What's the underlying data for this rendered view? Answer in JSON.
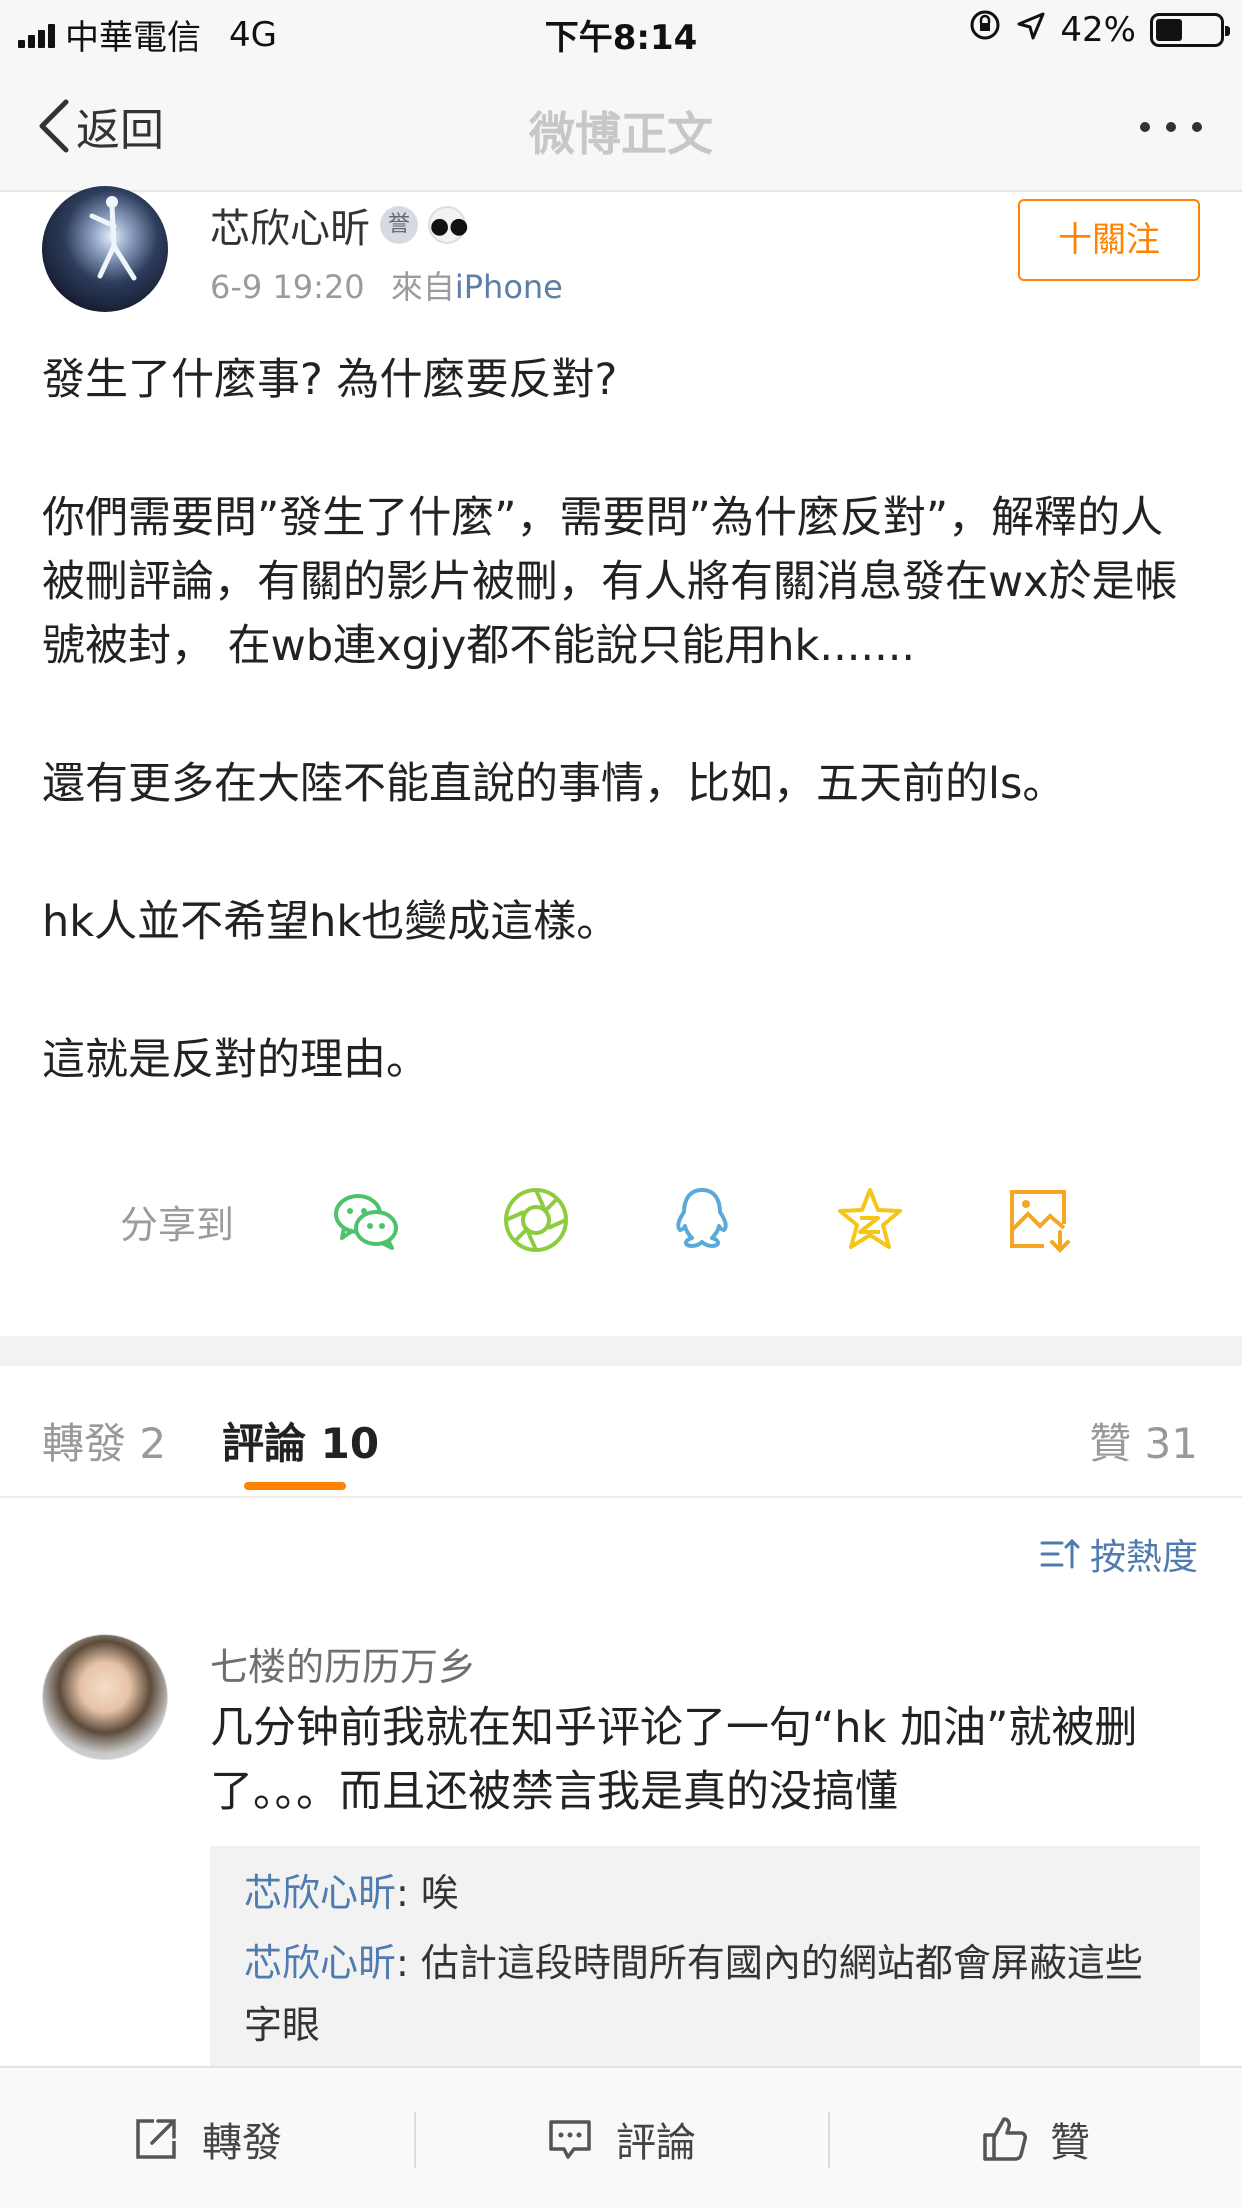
{
  "status_bar": {
    "carrier": "中華電信",
    "network": "4G",
    "time": "下午8:14",
    "battery_percent": "42%"
  },
  "nav": {
    "back_label": "返回",
    "title": "微博正文"
  },
  "post": {
    "author": "芯欣心昕",
    "timestamp": "6-9 19:20",
    "source_prefix": "來自",
    "source": "iPhone",
    "follow_label": "十關注",
    "paragraphs": [
      "發生了什麼事? 為什麼要反對?",
      "你們需要問”發生了什麼”，需要問”為什麼反對”，解釋的人被刪評論，有關的影片被刪，有人將有關消息發在wx於是帳號被封， 在wb連xgjy都不能說只能用hk.......",
      "還有更多在大陸不能直說的事情，比如，五天前的ls。",
      "hk人並不希望hk也變成這樣。",
      "這就是反對的理由。"
    ]
  },
  "share": {
    "label": "分享到",
    "targets": [
      "wechat-icon",
      "moments-icon",
      "qq-icon",
      "qzone-icon",
      "save-image-icon"
    ]
  },
  "tabs": {
    "repost": "轉發 2",
    "comments": "評論 10",
    "likes": "贊 31"
  },
  "sort_label": "按熱度",
  "comment": {
    "author": "七楼的历历万乡",
    "text": "几分钟前我就在知乎评论了一句“hk 加油”就被删了。。。而且还被禁言我是真的没搞懂",
    "replies": [
      {
        "name": "芯欣心昕",
        "text": ": 唉"
      },
      {
        "name": "芯欣心昕",
        "text": ": 估計這段時間所有國內的網站都會屏蔽這些字眼"
      }
    ]
  },
  "toolbar": {
    "repost": "轉發",
    "comment": "評論",
    "like": "贊"
  },
  "colors": {
    "accent_orange": "#ff8200",
    "link_blue": "#4f7cb0",
    "wechat_green": "#4cc36a",
    "qq_blue": "#5aa9d6",
    "star_yellow": "#f5c518"
  }
}
